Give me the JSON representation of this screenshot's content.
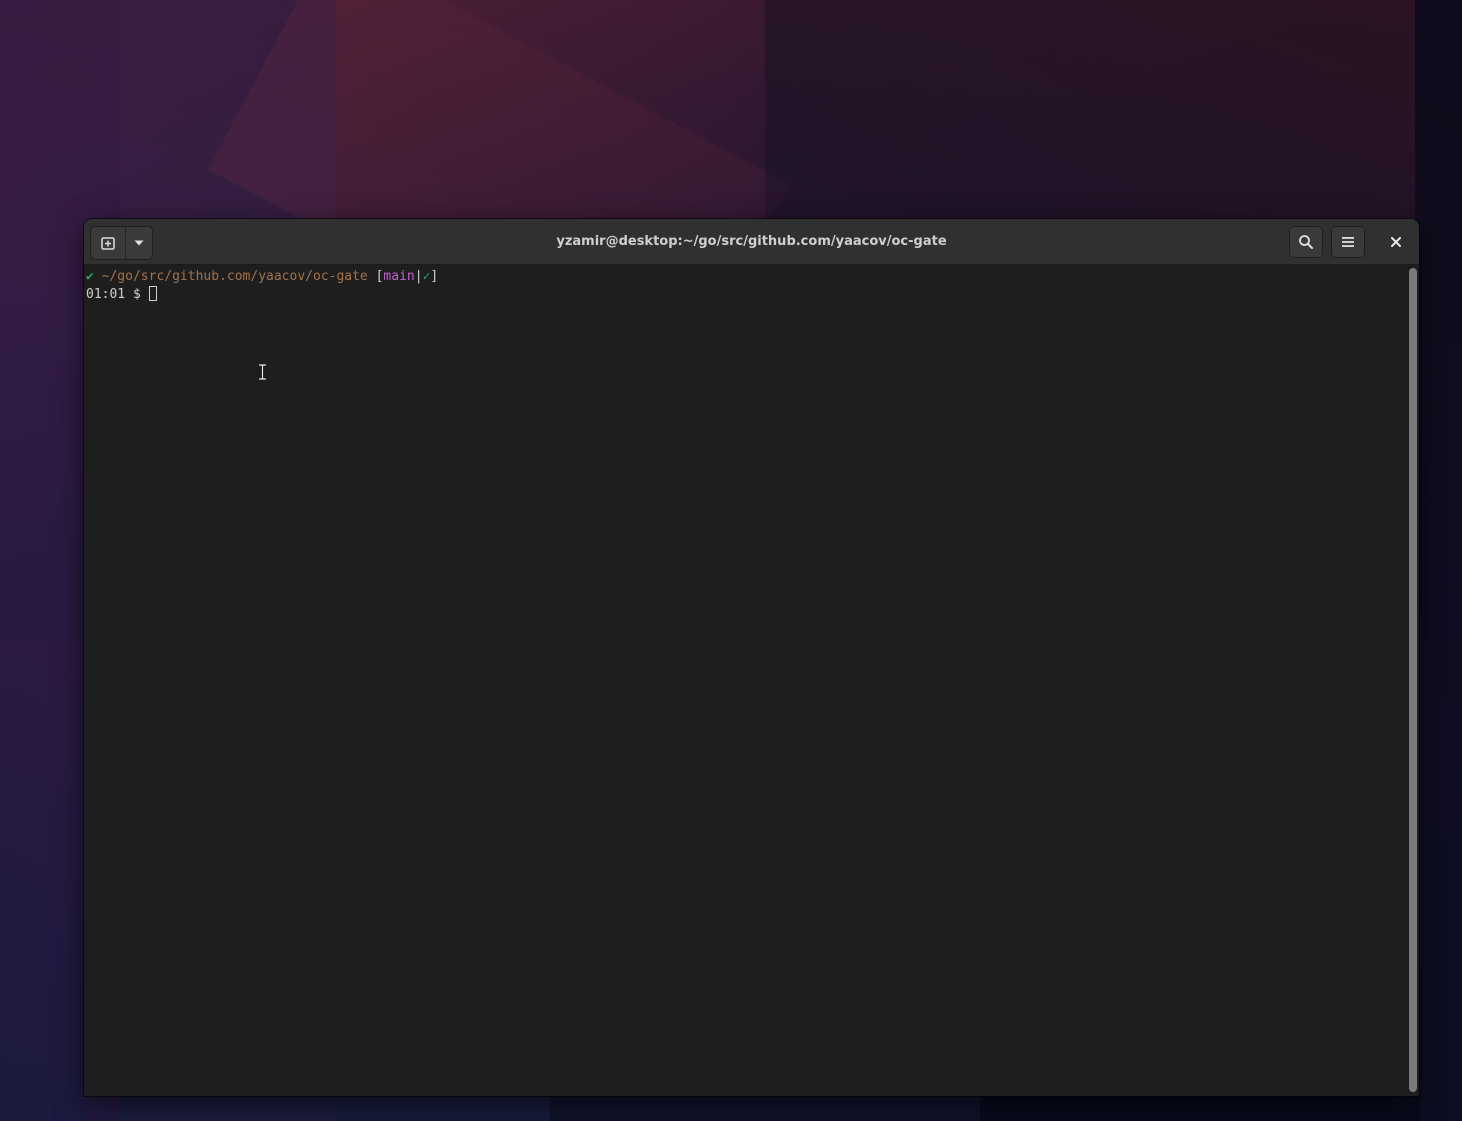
{
  "window": {
    "title": "yzamir@desktop:~/go/src/github.com/yaacov/oc-gate"
  },
  "headerbar": {
    "new_tab_icon": "new-tab-icon",
    "dropdown_icon": "chevron-down-icon",
    "search_icon": "search-icon",
    "menu_icon": "hamburger-menu-icon",
    "close_icon": "close-icon"
  },
  "terminal": {
    "prompt_line1": {
      "status_mark": "✔",
      "path": "~/go/src/github.com/yaacov/oc-gate",
      "bracket_open": "[",
      "branch": "main",
      "separator": "|",
      "clean_mark": "✓",
      "bracket_close": "]"
    },
    "prompt_line2": {
      "time": "01:01",
      "symbol": "$"
    }
  },
  "colors": {
    "status_ok": "#26a269",
    "path": "#a2734c",
    "branch": "#c061cb",
    "terminal_bg": "#1e1e1e",
    "headerbar_bg": "#303030"
  }
}
